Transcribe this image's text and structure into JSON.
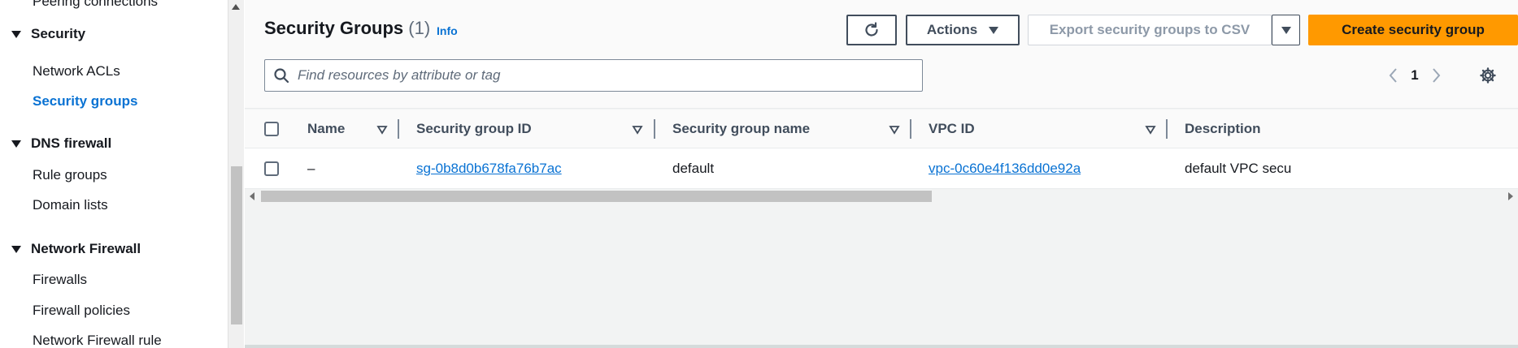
{
  "sidebar": {
    "items_top": [
      {
        "label": "Peering connections"
      }
    ],
    "sections": [
      {
        "title": "Security",
        "items": [
          "Network ACLs",
          "Security groups"
        ]
      },
      {
        "title": "DNS firewall",
        "items": [
          "Rule groups",
          "Domain lists"
        ]
      },
      {
        "title": "Network Firewall",
        "items": [
          "Firewalls",
          "Firewall policies",
          "Network Firewall rule"
        ]
      }
    ],
    "active_item": "Security groups"
  },
  "header": {
    "title": "Security Groups",
    "count": "(1)",
    "info": "Info",
    "actions_label": "Actions",
    "export_label": "Export security groups to CSV",
    "create_label": "Create security group"
  },
  "search": {
    "placeholder": "Find resources by attribute or tag"
  },
  "pagination": {
    "current_page": "1"
  },
  "table": {
    "columns": [
      "Name",
      "Security group ID",
      "Security group name",
      "VPC ID",
      "Description"
    ],
    "rows": [
      {
        "name": "–",
        "security_group_id": "sg-0b8d0b678fa76b7ac",
        "security_group_name": "default",
        "vpc_id": "vpc-0c60e4f136dd0e92a",
        "description": "default VPC secu"
      }
    ]
  },
  "colors": {
    "link": "#0972d3",
    "primary_button": "#ff9900",
    "text": "#16191f"
  }
}
